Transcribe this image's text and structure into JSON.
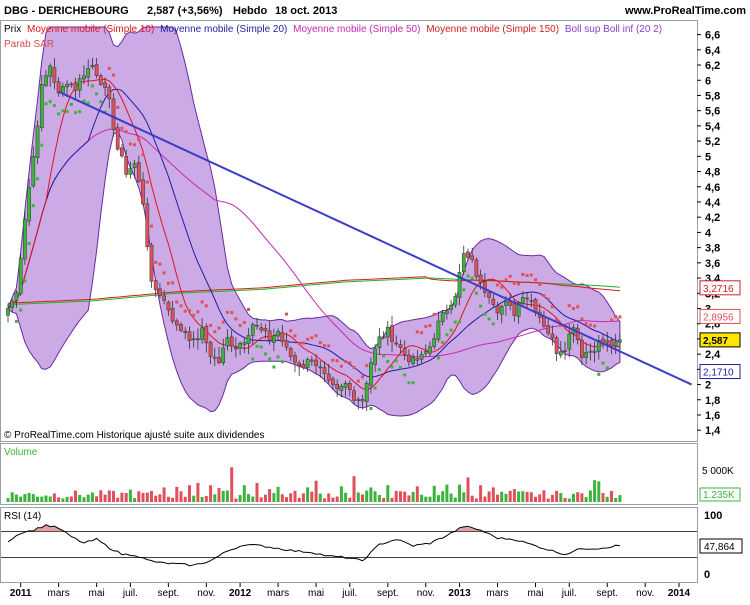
{
  "header": {
    "title": "DBG - DERICHEBOURG",
    "price_change": "2,587 (+3,56%)",
    "period": "Hebdo",
    "date": "18 oct. 2013",
    "site": "www.ProRealTime.com"
  },
  "legend": [
    {
      "text": "Prix",
      "color": "#000000"
    },
    {
      "text": "Moyenne mobile (Simple 10)",
      "color": "#e0141e"
    },
    {
      "text": "Moyenne mobile (Simple 20)",
      "color": "#1e1ea0"
    },
    {
      "text": "Moyenne mobile (Simple 50)",
      "color": "#c828b4"
    },
    {
      "text": "Moyenne mobile (Simple 150)",
      "color": "#d21e1e"
    },
    {
      "text": "Boll sup Boll inf (20 2)",
      "color": "#8c3cc8"
    }
  ],
  "legend2": {
    "text": "Parab SAR (0.02 0.02 0.2)",
    "visible_text": "Parab SAR",
    "color": "#d0504a"
  },
  "footer_note": "© ProRealTime.com Historique ajusté suite aux dividendes",
  "colors": {
    "up": "#3cb43c",
    "down": "#e0505a",
    "trendline": "#3c3cc8",
    "boll_fill": "#a064d2",
    "ma10": "#e0141e",
    "ma20": "#1e1ea0",
    "ma50": "#c828b4",
    "ma150": "#d21e1e",
    "ma_green": "#1eb41e",
    "sar_up": "#3cb43c",
    "sar_down": "#e0505a"
  },
  "price_axis": {
    "ticks": [
      "6,6",
      "6,4",
      "6,2",
      "6",
      "5,8",
      "5,6",
      "5,4",
      "5,2",
      "5",
      "4,8",
      "4,6",
      "4,4",
      "4,2",
      "4",
      "3,8",
      "3,6",
      "3,4",
      "3,2",
      "3",
      "2,8",
      "2,6",
      "2,4",
      "2,2",
      "2",
      "1,8",
      "1,6",
      "1,4"
    ],
    "tags": [
      {
        "label": "3,2716",
        "value": 3.2716,
        "color": "#d21e1e"
      },
      {
        "label": "2,8956",
        "value": 2.8956,
        "color": "#e0505a"
      },
      {
        "label": "2,587",
        "value": 2.587,
        "color": "#000000",
        "highlight": true
      },
      {
        "label": "2,1710",
        "value": 2.171,
        "color": "#1e1ea0"
      }
    ]
  },
  "volume_panel": {
    "title": "Volume",
    "tick": "5 000K",
    "last": "1.235K"
  },
  "rsi_panel": {
    "title": "RSI (14)",
    "ticks": [
      "100",
      "0"
    ],
    "last": "47,864",
    "levels": [
      70,
      30
    ]
  },
  "x_axis": {
    "labels": [
      {
        "text": "2011",
        "bold": true,
        "i": 3
      },
      {
        "text": "mars",
        "i": 12
      },
      {
        "text": "mai",
        "i": 21
      },
      {
        "text": "juil.",
        "i": 29
      },
      {
        "text": "sept.",
        "i": 38
      },
      {
        "text": "nov.",
        "i": 47
      },
      {
        "text": "2012",
        "bold": true,
        "i": 55
      },
      {
        "text": "mars",
        "i": 64
      },
      {
        "text": "mai",
        "i": 73
      },
      {
        "text": "juil.",
        "i": 81
      },
      {
        "text": "sept.",
        "i": 90
      },
      {
        "text": "nov.",
        "i": 99
      },
      {
        "text": "2013",
        "bold": true,
        "i": 107
      },
      {
        "text": "mars",
        "i": 116
      },
      {
        "text": "mai",
        "i": 125
      },
      {
        "text": "juil.",
        "i": 133
      },
      {
        "text": "sept.",
        "i": 142
      },
      {
        "text": "nov.",
        "i": 151
      },
      {
        "text": "2014",
        "bold": true,
        "i": 159
      }
    ]
  },
  "chart_data": {
    "type": "candlestick",
    "title": "DBG - DERICHEBOURG",
    "period": "weekly",
    "ylim": [
      1.4,
      6.7
    ],
    "price_anchors": [
      [
        0,
        3.0
      ],
      [
        2,
        3.2
      ],
      [
        4,
        4.2
      ],
      [
        6,
        5.0
      ],
      [
        8,
        5.9
      ],
      [
        10,
        6.2
      ],
      [
        12,
        5.8
      ],
      [
        14,
        6.0
      ],
      [
        16,
        5.9
      ],
      [
        18,
        6.1
      ],
      [
        20,
        6.2
      ],
      [
        22,
        6.0
      ],
      [
        24,
        5.7
      ],
      [
        26,
        5.1
      ],
      [
        28,
        4.8
      ],
      [
        30,
        4.9
      ],
      [
        32,
        4.4
      ],
      [
        34,
        3.3
      ],
      [
        36,
        3.2
      ],
      [
        38,
        3.0
      ],
      [
        40,
        2.75
      ],
      [
        42,
        2.7
      ],
      [
        44,
        2.55
      ],
      [
        46,
        2.7
      ],
      [
        48,
        2.4
      ],
      [
        50,
        2.3
      ],
      [
        52,
        2.6
      ],
      [
        54,
        2.5
      ],
      [
        56,
        2.6
      ],
      [
        58,
        2.8
      ],
      [
        60,
        2.7
      ],
      [
        62,
        2.6
      ],
      [
        64,
        2.7
      ],
      [
        66,
        2.45
      ],
      [
        68,
        2.3
      ],
      [
        70,
        2.25
      ],
      [
        72,
        2.35
      ],
      [
        74,
        2.2
      ],
      [
        76,
        2.0
      ],
      [
        78,
        1.9
      ],
      [
        80,
        2.0
      ],
      [
        82,
        1.85
      ],
      [
        84,
        1.8
      ],
      [
        86,
        2.3
      ],
      [
        88,
        2.6
      ],
      [
        90,
        2.7
      ],
      [
        92,
        2.55
      ],
      [
        94,
        2.4
      ],
      [
        96,
        2.3
      ],
      [
        98,
        2.35
      ],
      [
        100,
        2.5
      ],
      [
        102,
        2.8
      ],
      [
        104,
        3.0
      ],
      [
        106,
        3.2
      ],
      [
        108,
        3.7
      ],
      [
        110,
        3.6
      ],
      [
        112,
        3.3
      ],
      [
        114,
        3.2
      ],
      [
        116,
        3.0
      ],
      [
        118,
        3.05
      ],
      [
        120,
        2.95
      ],
      [
        122,
        3.2
      ],
      [
        124,
        3.1
      ],
      [
        126,
        2.9
      ],
      [
        128,
        2.7
      ],
      [
        130,
        2.45
      ],
      [
        132,
        2.5
      ],
      [
        134,
        2.8
      ],
      [
        136,
        2.4
      ],
      [
        138,
        2.45
      ],
      [
        140,
        2.55
      ],
      [
        142,
        2.55
      ],
      [
        144,
        2.5
      ],
      [
        145,
        2.587
      ]
    ],
    "volume_peaks": [
      [
        29,
        2200000
      ],
      [
        37,
        2600000
      ],
      [
        40,
        2700000
      ],
      [
        43,
        3000000
      ],
      [
        45,
        3400000
      ],
      [
        48,
        3000000
      ],
      [
        50,
        2500000
      ],
      [
        53,
        6200000
      ],
      [
        56,
        3000000
      ],
      [
        59,
        3400000
      ],
      [
        62,
        2300000
      ],
      [
        64,
        2700000
      ],
      [
        71,
        2600000
      ],
      [
        73,
        3800000
      ],
      [
        79,
        2800000
      ],
      [
        82,
        4600000
      ],
      [
        86,
        2600000
      ],
      [
        90,
        3000000
      ],
      [
        97,
        2800000
      ],
      [
        101,
        2900000
      ],
      [
        104,
        3100000
      ],
      [
        107,
        3100000
      ],
      [
        109,
        4400000
      ],
      [
        112,
        3000000
      ],
      [
        115,
        2600000
      ],
      [
        120,
        2300000
      ],
      [
        139,
        3900000
      ],
      [
        140,
        3700000
      ],
      [
        141,
        1600000
      ],
      [
        145,
        1235000
      ]
    ],
    "trendline": [
      [
        12,
        5.85
      ],
      [
        162,
        2.0
      ]
    ],
    "ma_green_anchors": [
      [
        0,
        3.05
      ],
      [
        20,
        3.1
      ],
      [
        40,
        3.2
      ],
      [
        60,
        3.25
      ],
      [
        80,
        3.35
      ],
      [
        100,
        3.4
      ],
      [
        120,
        3.35
      ],
      [
        140,
        3.3
      ],
      [
        145,
        3.28
      ]
    ],
    "rsi_anchors": [
      [
        0,
        55
      ],
      [
        3,
        68
      ],
      [
        6,
        72
      ],
      [
        9,
        80
      ],
      [
        12,
        75
      ],
      [
        15,
        62
      ],
      [
        18,
        52
      ],
      [
        21,
        58
      ],
      [
        24,
        45
      ],
      [
        27,
        35
      ],
      [
        30,
        34
      ],
      [
        33,
        26
      ],
      [
        36,
        22
      ],
      [
        40,
        20
      ],
      [
        44,
        18
      ],
      [
        48,
        25
      ],
      [
        52,
        40
      ],
      [
        56,
        50
      ],
      [
        60,
        48
      ],
      [
        64,
        44
      ],
      [
        68,
        40
      ],
      [
        72,
        38
      ],
      [
        76,
        32
      ],
      [
        80,
        30
      ],
      [
        84,
        25
      ],
      [
        88,
        50
      ],
      [
        92,
        58
      ],
      [
        96,
        48
      ],
      [
        100,
        52
      ],
      [
        104,
        64
      ],
      [
        108,
        78
      ],
      [
        112,
        72
      ],
      [
        116,
        60
      ],
      [
        120,
        58
      ],
      [
        124,
        50
      ],
      [
        128,
        42
      ],
      [
        132,
        35
      ],
      [
        136,
        44
      ],
      [
        140,
        44
      ],
      [
        144,
        47.864
      ]
    ]
  }
}
